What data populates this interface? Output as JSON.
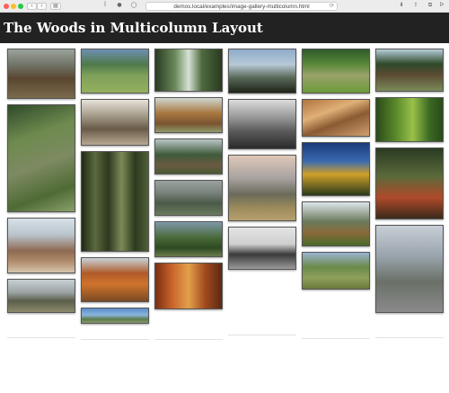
{
  "browser": {
    "url": "demos.local/examples/image-gallery-multicolumn.html",
    "back_label": "‹",
    "forward_label": "›",
    "sidebar_label": "▤",
    "reader_label": "ꟾ",
    "share_label": "⇪",
    "reload_label": "⟳",
    "download_label": "⬇",
    "tabs_label": "⧉",
    "relay_label": "ᐅ"
  },
  "page": {
    "title": "The Woods in Multicolumn Layout"
  },
  "photos": [
    {
      "col": 0,
      "bg": "linear-gradient(180deg,#9aa39b 0%,#6d6f62 35%,#5a4630 60%,#7a6a4c 100%)"
    },
    {
      "col": 0,
      "bg": "linear-gradient(160deg,#2f4a2a 0%,#6e8a4e 30%,#7d8a62 55%,#4f6b34 80%,#8aa06a 100%)"
    },
    {
      "col": 0,
      "bg": "linear-gradient(180deg,#d7e0e7 0%,#b9c4cc 30%,#8e6a52 60%,#b18d6d 80%,#d7c5ae 100%)"
    },
    {
      "col": 0,
      "bg": "linear-gradient(180deg,#c8d0d4 0%,#9aa2a3 40%,#5a5e4a 65%,#8a8a6a 100%)"
    },
    {
      "col": 1,
      "bg": "linear-gradient(180deg,#6e8fb2 0%,#4e7a4a 35%,#7fa05a 60%,#94b05e 100%)"
    },
    {
      "col": 1,
      "bg": "linear-gradient(180deg,#e7e3d9 0%,#a59c8a 35%,#6a5a48 65%,#b6a892 100%)"
    },
    {
      "col": 1,
      "bg": "linear-gradient(90deg,#1f2a16 0%,#5a6a3e 20%,#2d3820 40%,#7c8a58 60%,#2c3a1e 80%,#4f6036 100%)"
    },
    {
      "col": 1,
      "bg": "linear-gradient(180deg,#c9d3d8 0%,#b05a2a 35%,#d0742c 60%,#7a4a22 100%)"
    },
    {
      "col": 1,
      "bg": "linear-gradient(180deg,#5a8ec8 0%,#8ab4dc 45%,#5a7a4a 75%,#8a9a6a 100%)"
    },
    {
      "col": 2,
      "bg": "linear-gradient(90deg,#2a3a22 0%,#6a8a5a 30%,#d7e2d4 50%,#4e6a3e 70%,#2a3a22 100%)"
    },
    {
      "col": 2,
      "bg": "linear-gradient(180deg,#cfd6cf 0%,#a8763e 45%,#7a5430 75%,#8f9a6a 100%)"
    },
    {
      "col": 2,
      "bg": "linear-gradient(180deg,#b9c6c4 0%,#3e5a3a 45%,#6a5a42 75%,#4a5a34 100%)"
    },
    {
      "col": 2,
      "bg": "linear-gradient(180deg,#9aa2a0 0%,#7a827c 35%,#4a5a48 65%,#6a7a5c 100%)"
    },
    {
      "col": 2,
      "bg": "linear-gradient(180deg,#7e98aa 0%,#4a6a3a 45%,#2d4a22 75%,#6a7a4a 100%)"
    },
    {
      "col": 2,
      "bg": "linear-gradient(90deg,#7a2e12 0%,#c8642a 25%,#e2a04a 50%,#a24a1e 75%,#5a2a12 100%)"
    },
    {
      "col": 3,
      "bg": "linear-gradient(180deg,#8eaccb 0%,#b7c8d6 35%,#5a6a5a 65%,#1e2418 100%)"
    },
    {
      "col": 3,
      "bg": "linear-gradient(180deg,#dcdcdc 0%,#9a9a9a 35%,#5a5a5a 65%,#2a2a2a 100%)"
    },
    {
      "col": 3,
      "bg": "linear-gradient(180deg,#dfc8b8 0%,#a8a2a0 35%,#6a6a5a 60%,#9a8a5a 80%,#b8a070 100%)"
    },
    {
      "col": 3,
      "bg": "linear-gradient(180deg,#e4e4e4 0%,#cfcfcf 40%,#3a3a3a 65%,#9a9a9a 100%)"
    },
    {
      "col": 4,
      "bg": "linear-gradient(180deg,#2e5a2a 0%,#5a8a3a 35%,#9aa26a 60%,#6a9a3a 100%)"
    },
    {
      "col": 4,
      "bg": "linear-gradient(160deg,#b0733e 0%,#e0b078 35%,#8a5a32 60%,#d0a070 100%)"
    },
    {
      "col": 4,
      "bg": "linear-gradient(180deg,#1a3a7a 0%,#3a6ab0 35%,#d0a02a 60%,#2a3a1a 100%)"
    },
    {
      "col": 4,
      "bg": "linear-gradient(180deg,#dde6ea 0%,#6a7a5a 45%,#8a6a3a 70%,#4a6a2a 100%)"
    },
    {
      "col": 4,
      "bg": "linear-gradient(180deg,#9ab4d0 0%,#6a8a4a 40%,#8ea05a 70%,#6a7a3a 100%)"
    },
    {
      "col": 5,
      "bg": "linear-gradient(180deg,#b6ccd8 0%,#2e4a2a 35%,#5a4a32 60%,#7a8a5a 100%)"
    },
    {
      "col": 5,
      "bg": "linear-gradient(90deg,#2a4a1a 0%,#5a8a2a 30%,#9ac04a 55%,#3a6a22 80%,#2a4a1a 100%)"
    },
    {
      "col": 5,
      "bg": "linear-gradient(180deg,#2a3a22 0%,#5a6a3a 40%,#b04a2a 70%,#3a2a1a 100%)"
    },
    {
      "col": 5,
      "bg": "linear-gradient(180deg,#c7ced6 0%,#9aa4ac 35%,#6a7068 65%,#8a8a8a 100%)"
    }
  ]
}
